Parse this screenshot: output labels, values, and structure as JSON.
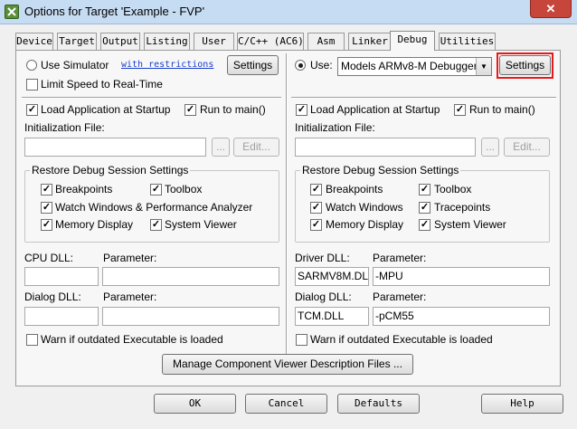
{
  "window": {
    "title": "Options for Target 'Example - FVP'",
    "close_label": "✕"
  },
  "tabs": [
    "Device",
    "Target",
    "Output",
    "Listing",
    "User",
    "C/C++ (AC6)",
    "Asm",
    "Linker",
    "Debug",
    "Utilities"
  ],
  "active_tab": "Debug",
  "left": {
    "use_simulator_label": "Use Simulator",
    "with_restrictions_link": "with restrictions",
    "settings_label": "Settings",
    "limit_speed_label": "Limit Speed to Real-Time",
    "load_app_label": "Load Application at Startup",
    "run_to_main_label": "Run to main()",
    "init_file_label": "Initialization File:",
    "browse_label": "...",
    "edit_label": "Edit...",
    "restore_group_label": "Restore Debug Session Settings",
    "breakpoints_label": "Breakpoints",
    "toolbox_label": "Toolbox",
    "watch_label": "Watch Windows & Performance Analyzer",
    "memory_label": "Memory Display",
    "system_viewer_label": "System Viewer",
    "cpu_dll_label": "CPU DLL:",
    "parameter_label": "Parameter:",
    "dialog_dll_label": "Dialog DLL:",
    "cpu_dll_value": "",
    "cpu_param_value": "",
    "dialog_dll_value": "",
    "dialog_param_value": "",
    "warn_label": "Warn if outdated Executable is loaded"
  },
  "right": {
    "use_label": "Use:",
    "debugger_value": "Models ARMv8-M Debugger",
    "settings_label": "Settings",
    "load_app_label": "Load Application at Startup",
    "run_to_main_label": "Run to main()",
    "init_file_label": "Initialization File:",
    "browse_label": "...",
    "edit_label": "Edit...",
    "restore_group_label": "Restore Debug Session Settings",
    "breakpoints_label": "Breakpoints",
    "toolbox_label": "Toolbox",
    "watch_label": "Watch Windows",
    "tracepoints_label": "Tracepoints",
    "memory_label": "Memory Display",
    "system_viewer_label": "System Viewer",
    "driver_dll_label": "Driver DLL:",
    "parameter_label": "Parameter:",
    "dialog_dll_label": "Dialog DLL:",
    "driver_dll_value": "SARMV8M.DLL",
    "driver_param_value": "-MPU",
    "dialog_dll_value": "TCM.DLL",
    "dialog_param_value": "-pCM55",
    "warn_label": "Warn if outdated Executable is loaded"
  },
  "manage_button_label": "Manage Component Viewer Description Files ...",
  "footer": {
    "ok_label": "OK",
    "cancel_label": "Cancel",
    "defaults_label": "Defaults",
    "help_label": "Help"
  },
  "check_mark": "✓",
  "colors": {
    "highlight": "#e8191b",
    "link": "#1a3ecc",
    "titlebar": "#c6dcf2",
    "close_button": "#c7463c"
  }
}
